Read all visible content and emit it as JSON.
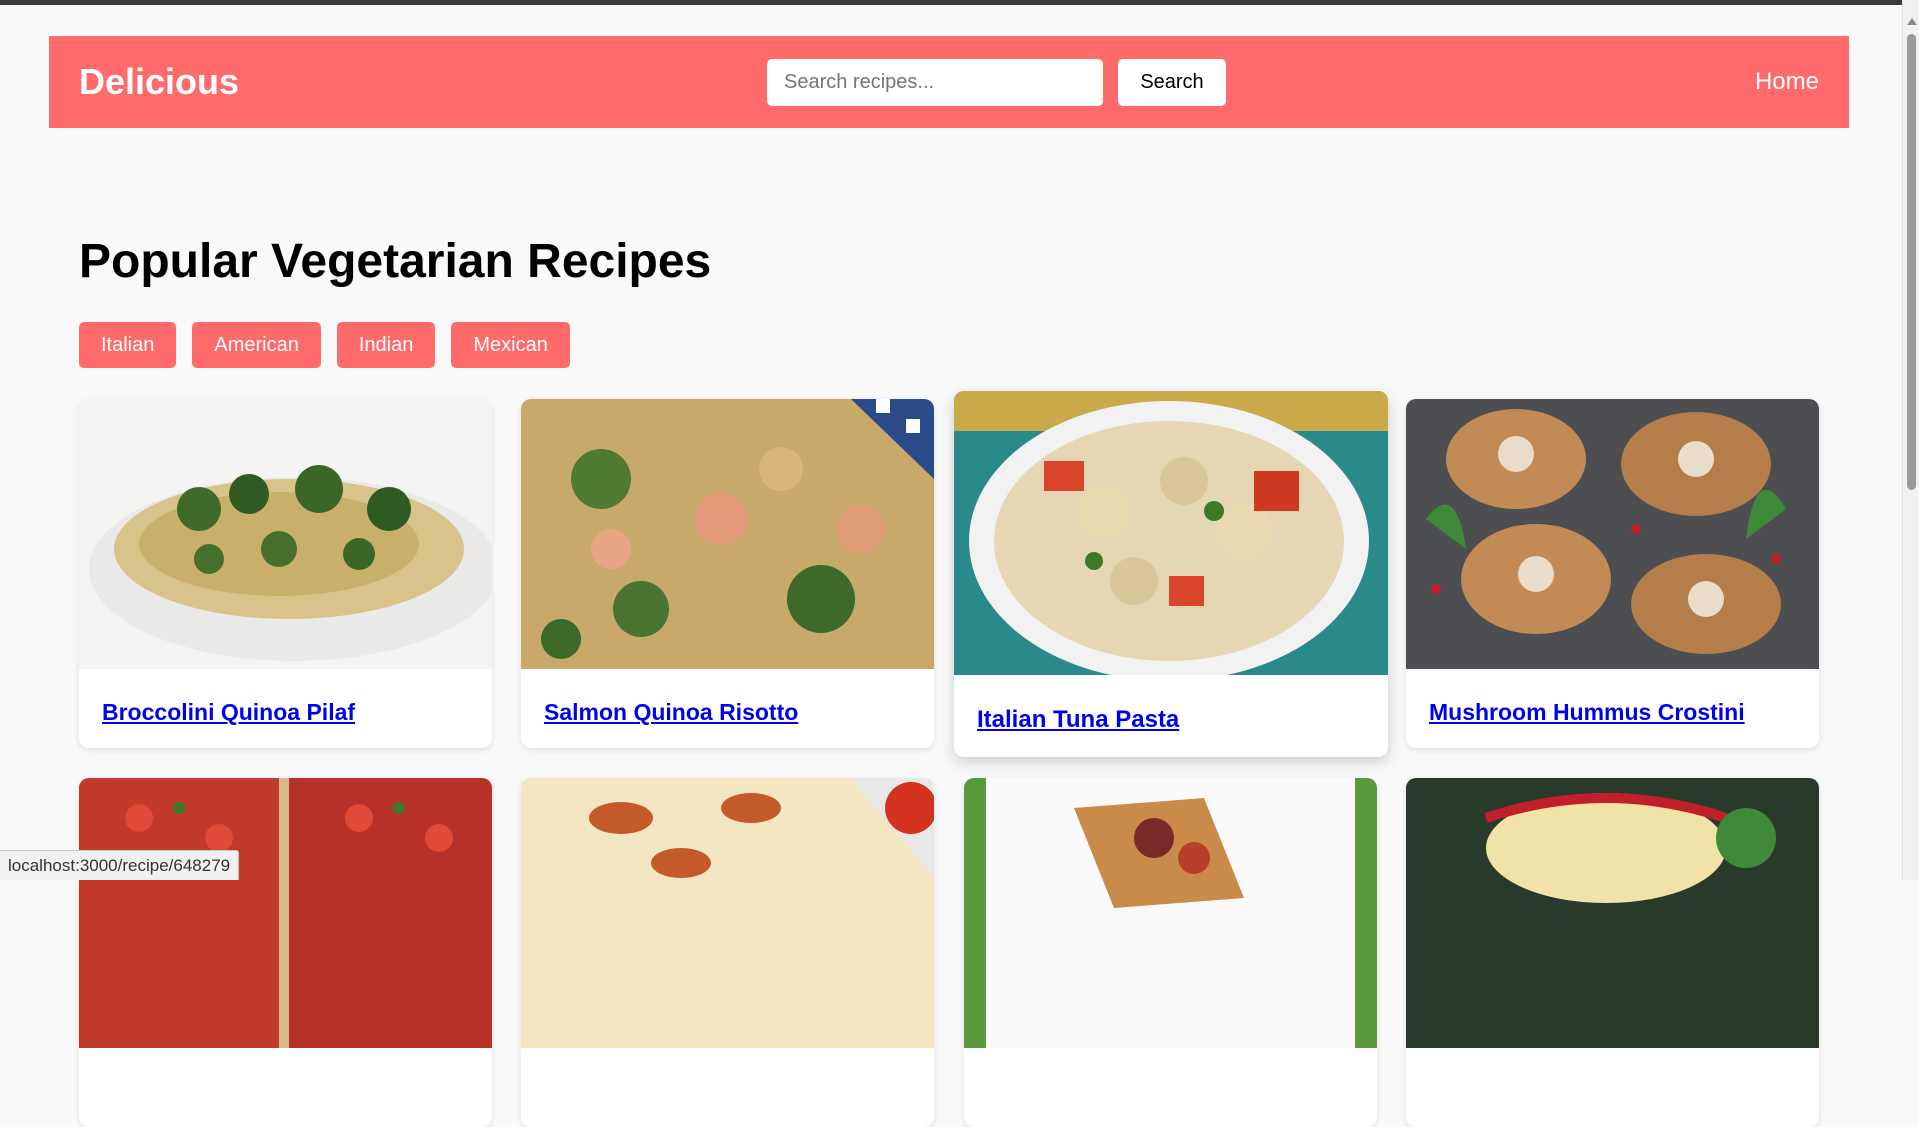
{
  "navbar": {
    "brand": "Delicious",
    "search_placeholder": "Search recipes...",
    "search_label": "Search",
    "home_label": "Home"
  },
  "main": {
    "title": "Popular Vegetarian Recipes",
    "cuisines": [
      "Italian",
      "American",
      "Indian",
      "Mexican"
    ],
    "recipes": [
      "Broccolini Quinoa Pilaf",
      "Salmon Quinoa Risotto",
      "Italian Tuna Pasta",
      "Mushroom Hummus Crostini"
    ]
  },
  "status_bar": {
    "url": "localhost:3000/recipe/648279"
  },
  "colors": {
    "accent": "#ff6b6b",
    "link": "#0000ee",
    "background": "#f9f9f9"
  }
}
